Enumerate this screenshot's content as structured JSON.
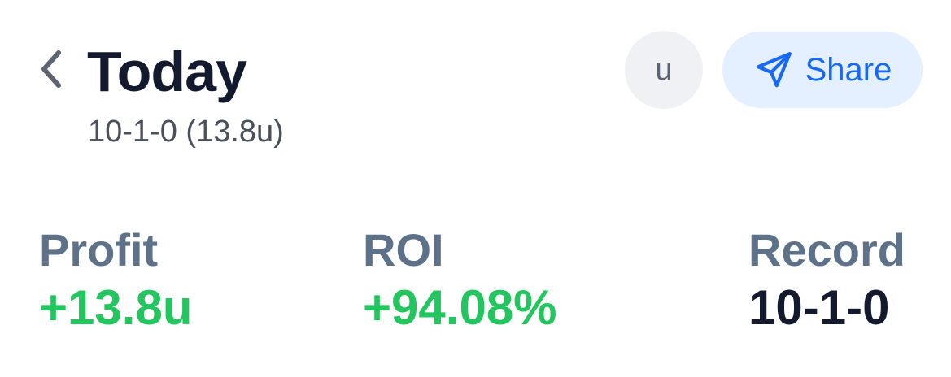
{
  "header": {
    "title": "Today",
    "subtitle": "10-1-0 (13.8u)",
    "unit_label": "u",
    "share_label": "Share"
  },
  "icons": {
    "back": "chevron-left-icon",
    "share": "paper-plane-icon"
  },
  "stats": [
    {
      "label": "Profit",
      "value": "+13.8u",
      "color": "#22c55e"
    },
    {
      "label": "ROI",
      "value": "+94.08%",
      "color": "#22c55e"
    },
    {
      "label": "Record",
      "value": "10-1-0",
      "color": "#141a2e"
    }
  ],
  "colors": {
    "accent": "#1769f2",
    "share_bg": "#e4efff",
    "positive": "#22c55e",
    "label": "#5d7188"
  }
}
